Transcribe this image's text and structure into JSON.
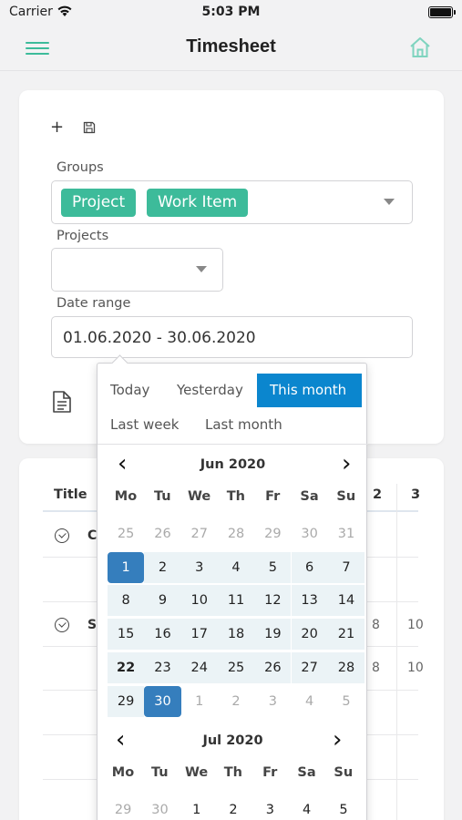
{
  "status": {
    "carrier": "Carrier",
    "time": "5:03 PM"
  },
  "nav": {
    "title": "Timesheet"
  },
  "filters": {
    "groups_label": "Groups",
    "group_chips": [
      "Project",
      "Work Item"
    ],
    "projects_label": "Projects",
    "date_range_label": "Date range",
    "date_range_value": "01.06.2020 - 30.06.2020"
  },
  "table": {
    "header_title": "Title",
    "col_headers": [
      "2",
      "3"
    ],
    "rows": [
      {
        "title": "C",
        "values": [
          "",
          ""
        ]
      },
      {
        "title": "S",
        "values": [
          "8",
          "10"
        ]
      },
      {
        "title": "",
        "values": [
          "8",
          "10"
        ]
      }
    ]
  },
  "picker": {
    "ranges": [
      "Today",
      "Yesterday",
      "This month",
      "Last week",
      "Last month"
    ],
    "active_range": "This month",
    "weekdays": [
      "Mo",
      "Tu",
      "We",
      "Th",
      "Fr",
      "Sa",
      "Su"
    ],
    "calendars": [
      {
        "title": "Jun 2020",
        "days": [
          [
            "25",
            "26",
            "27",
            "28",
            "29",
            "30",
            "31"
          ],
          [
            "1",
            "2",
            "3",
            "4",
            "5",
            "6",
            "7"
          ],
          [
            "8",
            "9",
            "10",
            "11",
            "12",
            "13",
            "14"
          ],
          [
            "15",
            "16",
            "17",
            "18",
            "19",
            "20",
            "21"
          ],
          [
            "22",
            "23",
            "24",
            "25",
            "26",
            "27",
            "28"
          ],
          [
            "29",
            "30",
            "1",
            "2",
            "3",
            "4",
            "5"
          ]
        ]
      },
      {
        "title": "Jul 2020",
        "days": [
          [
            "29",
            "30",
            "1",
            "2",
            "3",
            "4",
            "5"
          ]
        ]
      }
    ]
  },
  "colors": {
    "accent": "#3dbb9a",
    "selected": "#357ebd",
    "active_range": "#0b86ce",
    "in_range": "#ebf3f6"
  },
  "icons": [
    "wifi-icon",
    "menu-icon",
    "home-icon",
    "add-icon",
    "save-icon",
    "chevron-down-icon",
    "document-icon",
    "expand-icon",
    "chevron-left-icon",
    "chevron-right-icon"
  ]
}
